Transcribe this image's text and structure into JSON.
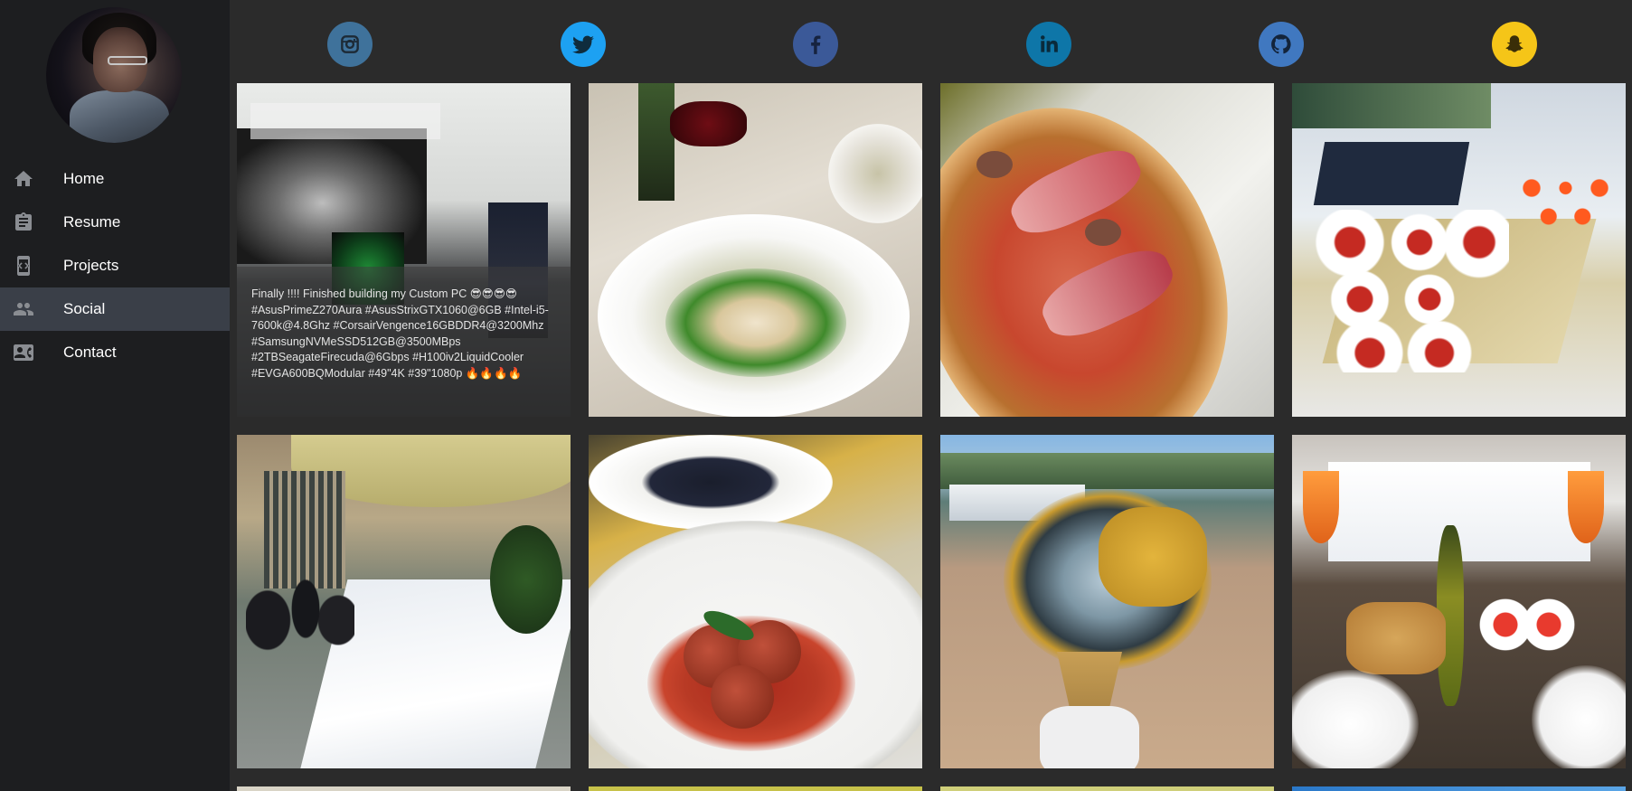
{
  "sidebar": {
    "nav": [
      {
        "label": "Home",
        "icon": "home-icon"
      },
      {
        "label": "Resume",
        "icon": "clipboard-icon"
      },
      {
        "label": "Projects",
        "icon": "code-icon"
      },
      {
        "label": "Social",
        "icon": "people-icon",
        "active": true
      },
      {
        "label": "Contact",
        "icon": "contact-card-icon"
      }
    ]
  },
  "social_links": [
    {
      "icon": "instagram-icon",
      "color": "#3f729b"
    },
    {
      "icon": "twitter-icon",
      "color": "#1da1f2"
    },
    {
      "icon": "facebook-icon",
      "color": "#3b5998"
    },
    {
      "icon": "linkedin-icon",
      "color": "#0e76a8"
    },
    {
      "icon": "github-icon",
      "color": "#4078c0"
    },
    {
      "icon": "snapchat-icon",
      "color": "#fffc00"
    }
  ],
  "gallery": {
    "caption": "Finally !!!! Finished building my Custom PC 😎😎😎😎 #AsusPrimeZ270Aura #AsusStrixGTX1060@6GB #Intel-i5-7600k@4.8Ghz #CorsairVengence16GBDDR4@3200Mhz #SamsungNVMeSSD512GB@3500MBps #2TBSeagateFirecuda@6Gbps #H100iv2LiquidCooler #EVGA600BQModular #49\"4K #39\"1080p 🔥🔥🔥🔥",
    "posts": [
      {
        "subject": "custom-pc-build"
      },
      {
        "subject": "shrimp-salad-and-wine"
      },
      {
        "subject": "prosciutto-pizza"
      },
      {
        "subject": "tomato-appetizers"
      },
      {
        "subject": "outdoor-buffet"
      },
      {
        "subject": "meatballs"
      },
      {
        "subject": "gelato-harbor"
      },
      {
        "subject": "table-aperitivo"
      }
    ]
  }
}
